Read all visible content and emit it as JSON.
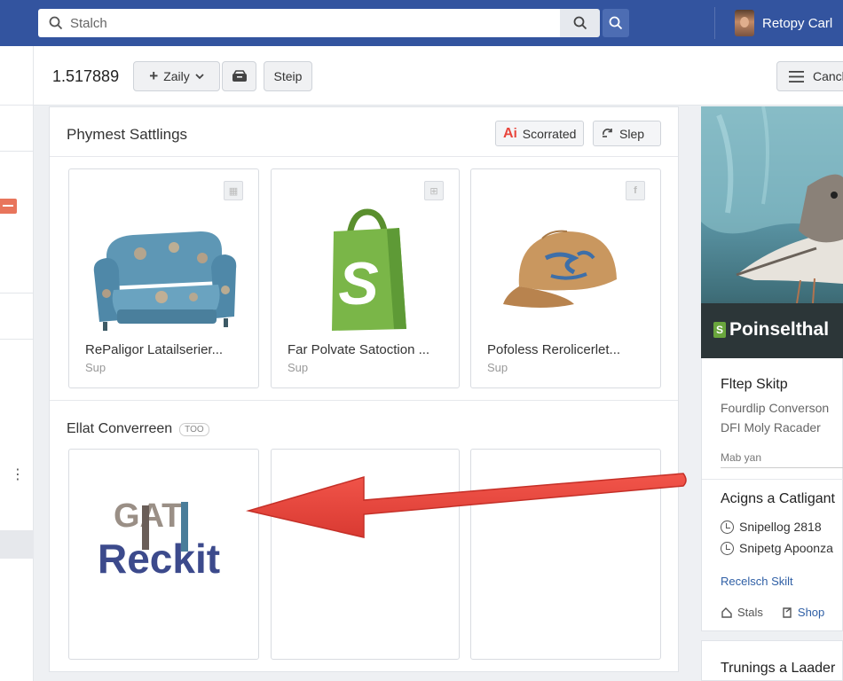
{
  "topbar": {
    "search_placeholder": "Stalch",
    "user_name": "Retopy Carl"
  },
  "toolbar": {
    "number": "1.517889",
    "dropdown_label": "Zaily",
    "step_label": "Steip",
    "right_button_label": "Cancl"
  },
  "panel": {
    "title": "Phymest Sattlings",
    "buttons": [
      {
        "label": "Scorrated",
        "icon": "ai-icon"
      },
      {
        "label": "Slep",
        "icon": "refresh-icon"
      }
    ],
    "products": [
      {
        "name": "RePaligor Latailserier...",
        "sub": "Sup",
        "image": "armchair-image"
      },
      {
        "name": "Far Polvate Satoction ...",
        "sub": "Sup",
        "image": "shopify-bag-image"
      },
      {
        "name": "Pofoless Rerolicerlet...",
        "sub": "Sup",
        "image": "cap-image"
      }
    ],
    "section2_title": "Ellat Converreen",
    "section2_tag": "TOO",
    "logo_text_top": "GAT",
    "logo_text_bottom": "Reckit"
  },
  "right": {
    "hero_title": "Poinselthal",
    "hero_badge": "S",
    "heading1": "Fltep Skitp",
    "text1": "Fourdlip Converson",
    "text2": "DFI Moly Racader",
    "input_value": "Mab yan",
    "heading2": "Acigns a Catligant",
    "items": [
      "Snipellog 2818",
      "Snipetg Apoonza"
    ],
    "link": "Recelsch Skilt",
    "footer": [
      "Stals",
      "Shop"
    ],
    "heading3": "Trunings a Laader"
  },
  "colors": {
    "topbar": "#33549f",
    "accent_red": "#e8453c",
    "shopify_green": "#6aa63d",
    "link_blue": "#2f5fa5"
  }
}
